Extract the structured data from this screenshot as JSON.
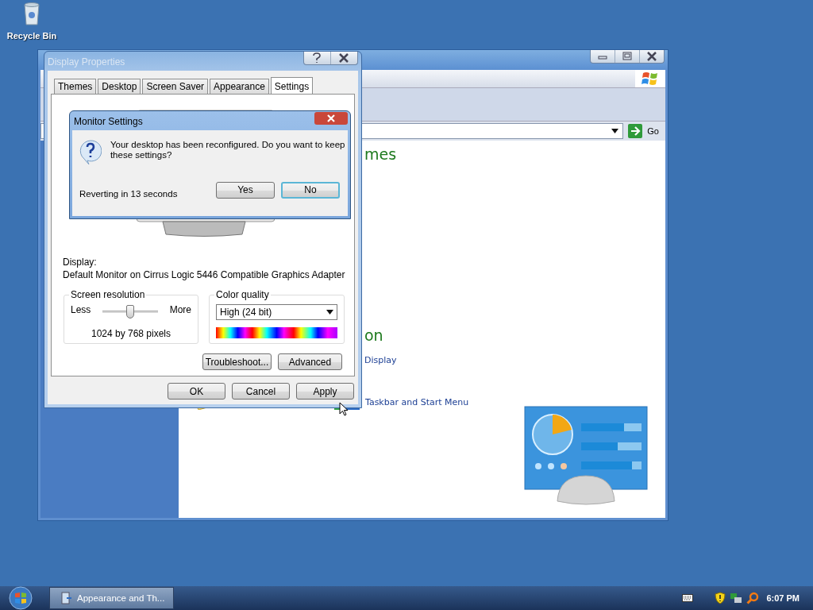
{
  "desktop_icons": [
    {
      "label": "Recycle Bin"
    }
  ],
  "control_panel": {
    "address_button": "Go",
    "heading_1": "mes",
    "heading_2": "on",
    "links": [
      "Display",
      "Taskbar and Start Menu"
    ]
  },
  "display_properties": {
    "title": "Display Properties",
    "active": false,
    "tabs": [
      {
        "label": "Themes",
        "selected": false
      },
      {
        "label": "Desktop",
        "selected": false
      },
      {
        "label": "Screen Saver",
        "selected": false
      },
      {
        "label": "Appearance",
        "selected": false
      },
      {
        "label": "Settings",
        "selected": true
      }
    ],
    "display_label": "Display:",
    "display_device": "Default Monitor on Cirrus Logic 5446 Compatible Graphics Adapter",
    "resolution": {
      "title": "Screen resolution",
      "min_label": "Less",
      "max_label": "More",
      "level": 0.5,
      "reading": "1024 by 768 pixels"
    },
    "color_quality": {
      "title": "Color quality",
      "value": "High (24 bit)"
    },
    "panel_buttons": [
      "Troubleshoot...",
      "Advanced"
    ],
    "buttons": [
      "OK",
      "Cancel",
      "Apply"
    ]
  },
  "monitor_settings": {
    "title": "Monitor Settings",
    "message": "Your desktop has been reconfigured.  Do you want to keep these settings?",
    "countdown": "Reverting in 13 seconds",
    "buttons": [
      {
        "label": "Yes",
        "focused": false
      },
      {
        "label": "No",
        "focused": true
      }
    ]
  },
  "taskbar": {
    "tasks": [
      {
        "label": "Appearance and Th...",
        "selected": true
      }
    ],
    "clock": "6:07 PM"
  }
}
